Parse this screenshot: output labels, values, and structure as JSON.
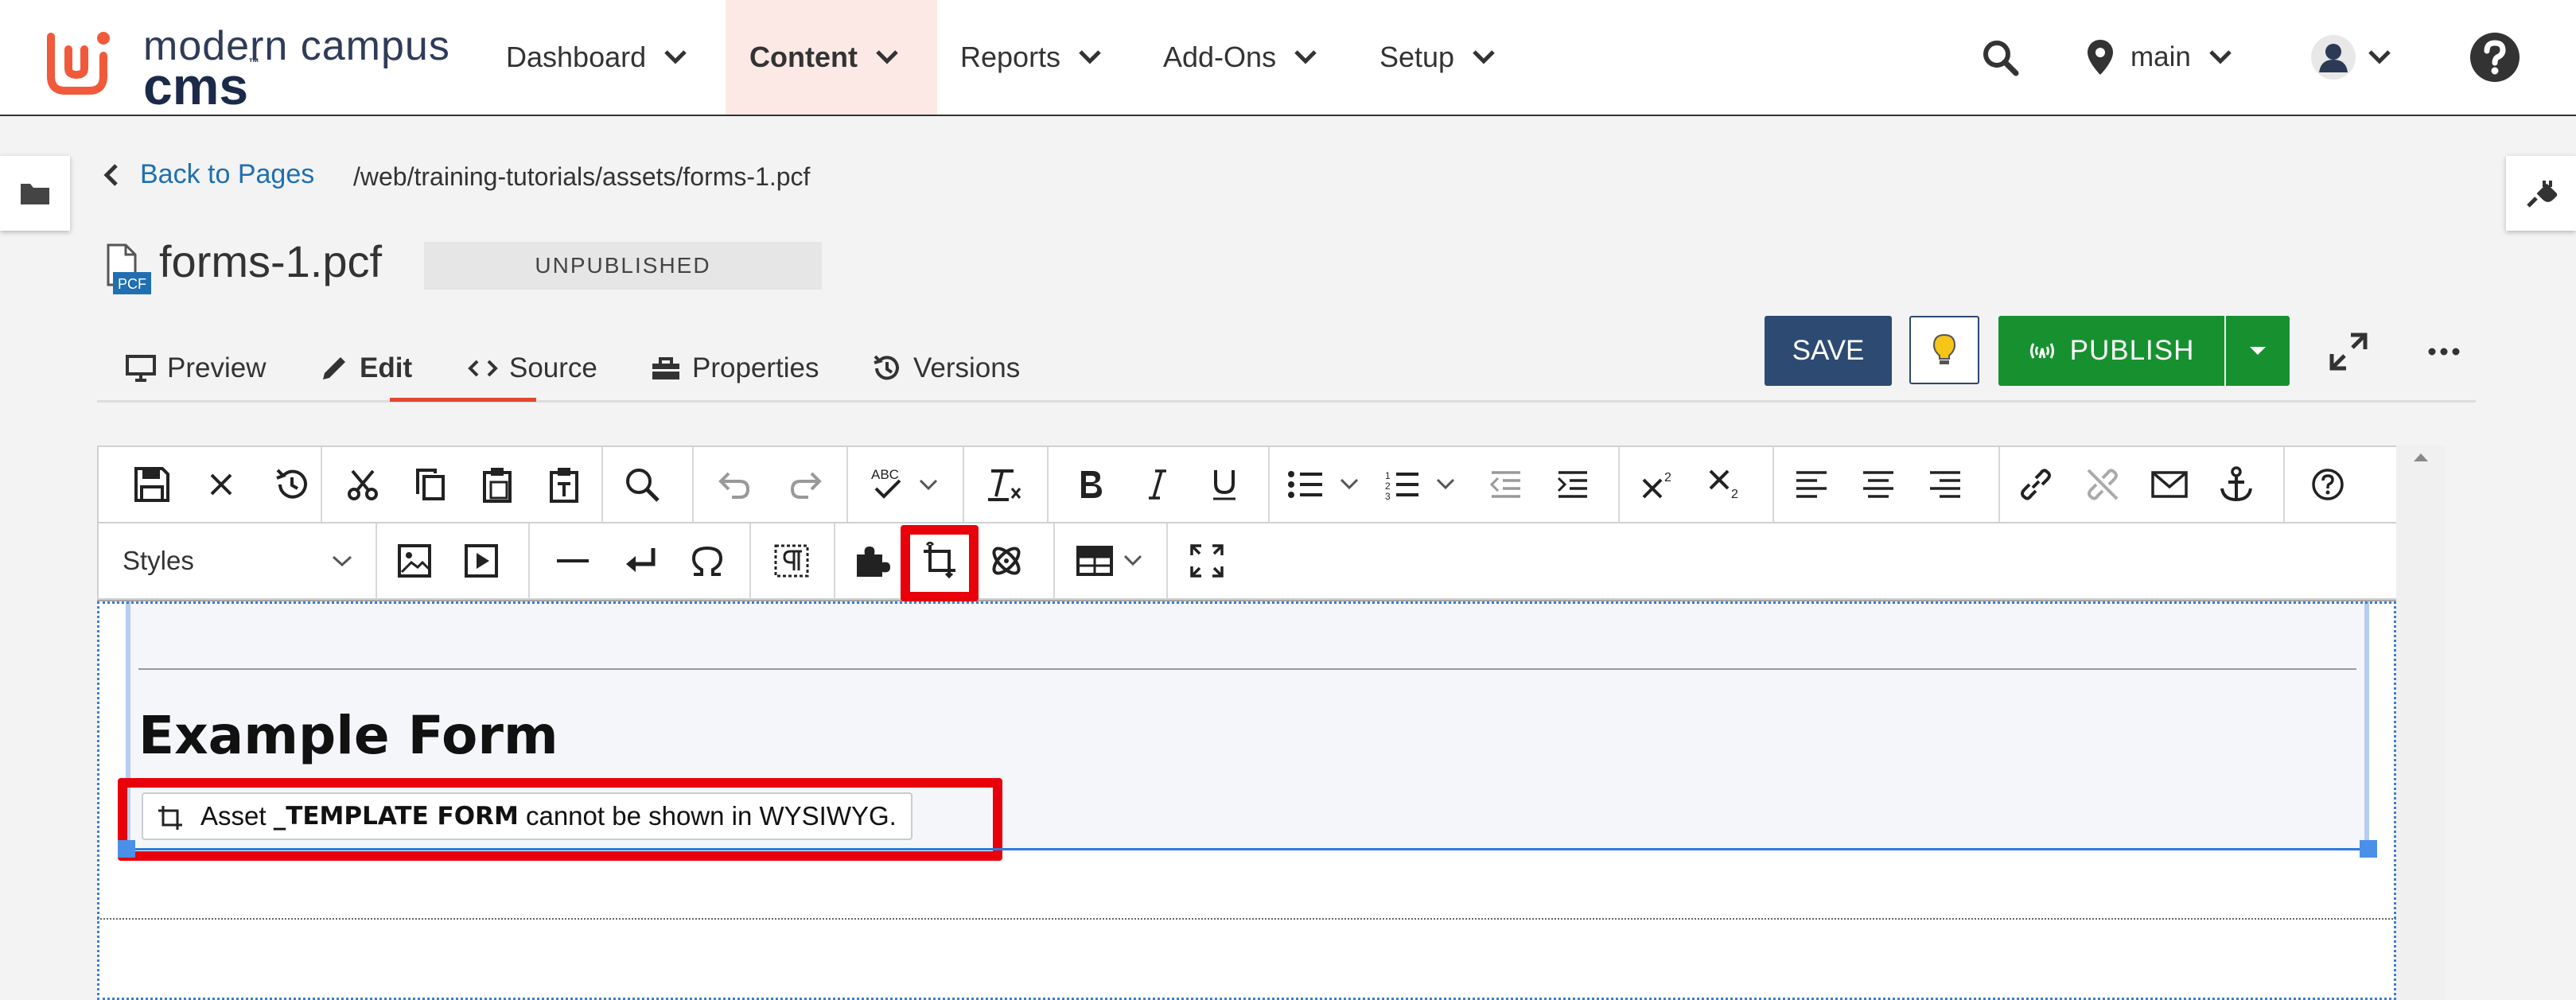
{
  "brand": {
    "line1": "modern campus",
    "line2": "cms",
    "tm": "™",
    "accent": "#f05a3a"
  },
  "nav": {
    "items": [
      {
        "label": "Dashboard",
        "active": false
      },
      {
        "label": "Content",
        "active": true
      },
      {
        "label": "Reports",
        "active": false
      },
      {
        "label": "Add-Ons",
        "active": false
      },
      {
        "label": "Setup",
        "active": false
      }
    ],
    "site": "main"
  },
  "breadcrumb": {
    "back": "Back to Pages",
    "path": "/web/training-tutorials/assets/forms-1.pcf"
  },
  "file": {
    "name": "forms-1.pcf",
    "icon_label": "PCF",
    "status": "UNPUBLISHED"
  },
  "tabs": [
    {
      "label": "Preview",
      "icon": "monitor-icon"
    },
    {
      "label": "Edit",
      "icon": "pencil-icon",
      "active": true
    },
    {
      "label": "Source",
      "icon": "code-icon"
    },
    {
      "label": "Properties",
      "icon": "toolbox-icon"
    },
    {
      "label": "Versions",
      "icon": "history-icon"
    }
  ],
  "actions": {
    "save": "SAVE",
    "publish": "PUBLISH"
  },
  "toolbar": {
    "styles_label": "Styles"
  },
  "content": {
    "heading": "Example Form",
    "asset_prefix": "Asset ",
    "asset_name": "_TEMPLATE FORM",
    "asset_suffix": " cannot be shown in WYSIWYG."
  },
  "colors": {
    "save": "#2d4a72",
    "publish": "#17912f",
    "highlight": "#e8000b",
    "link": "#1f6fb2"
  }
}
